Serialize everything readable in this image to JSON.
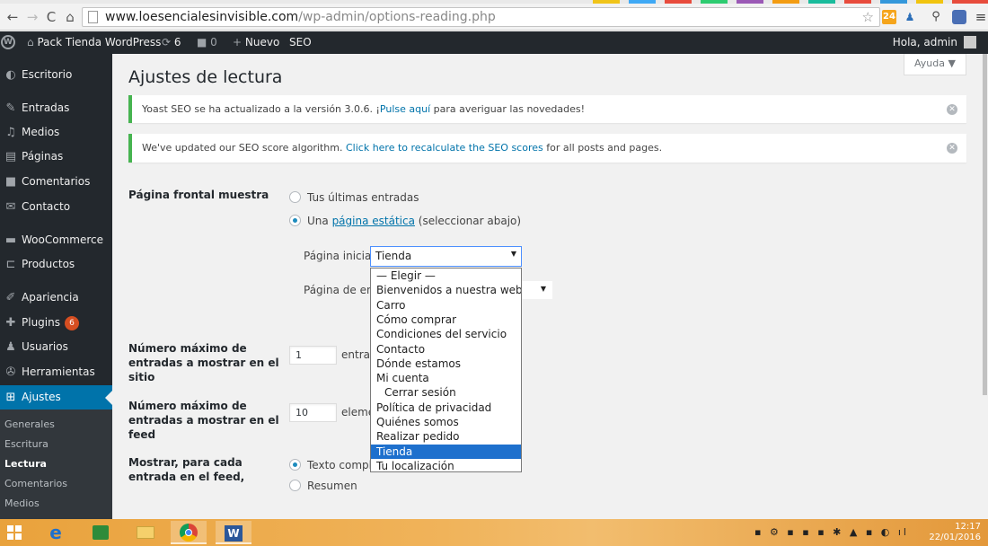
{
  "browser": {
    "url_host": "www.loesencialesinvisible.com",
    "url_path": "/wp-admin/options-reading.php",
    "ext_badge": "24"
  },
  "admin_bar": {
    "site_name": "Pack Tienda WordPress",
    "updates_count": "6",
    "comments_count": "0",
    "new_label": "Nuevo",
    "seo_label": "SEO",
    "greeting": "Hola, admin"
  },
  "sidebar": {
    "items": [
      {
        "label": "Escritorio"
      },
      {
        "label": "Entradas"
      },
      {
        "label": "Medios"
      },
      {
        "label": "Páginas"
      },
      {
        "label": "Comentarios"
      },
      {
        "label": "Contacto"
      },
      {
        "label": "WooCommerce"
      },
      {
        "label": "Productos"
      },
      {
        "label": "Apariencia"
      },
      {
        "label": "Plugins",
        "badge": "6"
      },
      {
        "label": "Usuarios"
      },
      {
        "label": "Herramientas"
      },
      {
        "label": "Ajustes"
      }
    ],
    "submenu": [
      "Generales",
      "Escritura",
      "Lectura",
      "Comentarios",
      "Medios"
    ]
  },
  "page": {
    "help_label": "Ayuda ▼",
    "title": "Ajustes de lectura"
  },
  "notices": {
    "yoast": {
      "before": "Yoast SEO se ha actualizado a la versión 3.0.6. ¡",
      "link": "Pulse aquí",
      "after": " para averiguar las novedades!"
    },
    "seo_score": {
      "before": "We've updated our SEO score algorithm. ",
      "link": "Click here to recalculate the SEO scores",
      "after": " for all posts and pages."
    }
  },
  "form": {
    "front_page_label": "Página frontal muestra",
    "radio_latest": "Tus últimas entradas",
    "radio_static_before": "Una ",
    "radio_static_link": "página estática",
    "radio_static_after": " (seleccionar abajo)",
    "home_page_label": "Página inicial:",
    "home_page_value": "Tienda",
    "posts_page_label": "Página de entr",
    "blog_pages_label": "Número máximo de entradas a mostrar en el sitio",
    "blog_pages_value": "1",
    "blog_pages_after": "entrad",
    "feed_label": "Número máximo de entradas a mostrar en el feed",
    "feed_value": "10",
    "feed_after": "eleme",
    "feed_show_label": "Mostrar, para cada entrada en el feed,",
    "radio_full_text": "Texto comple",
    "radio_summary": "Resumen"
  },
  "dropdown": {
    "options": [
      {
        "label": "— Elegir —"
      },
      {
        "label": "Bienvenidos a nuestra web"
      },
      {
        "label": "Carro"
      },
      {
        "label": "Cómo comprar"
      },
      {
        "label": "Condiciones del servicio"
      },
      {
        "label": "Contacto"
      },
      {
        "label": "Dónde estamos"
      },
      {
        "label": "Mi cuenta"
      },
      {
        "label": "Cerrar sesión",
        "indent": true
      },
      {
        "label": "Política de privacidad"
      },
      {
        "label": "Quiénes somos"
      },
      {
        "label": "Realizar pedido"
      },
      {
        "label": "Tienda",
        "selected": true
      },
      {
        "label": "Tu localización"
      }
    ]
  },
  "taskbar": {
    "time": "12:17",
    "date": "22/01/2016"
  },
  "colors": {
    "admin_bar": "#23282d",
    "accent": "#0073aa",
    "notice_border": "#46b450",
    "selected_option": "#1e70cd",
    "plugin_badge": "#d54e21"
  }
}
